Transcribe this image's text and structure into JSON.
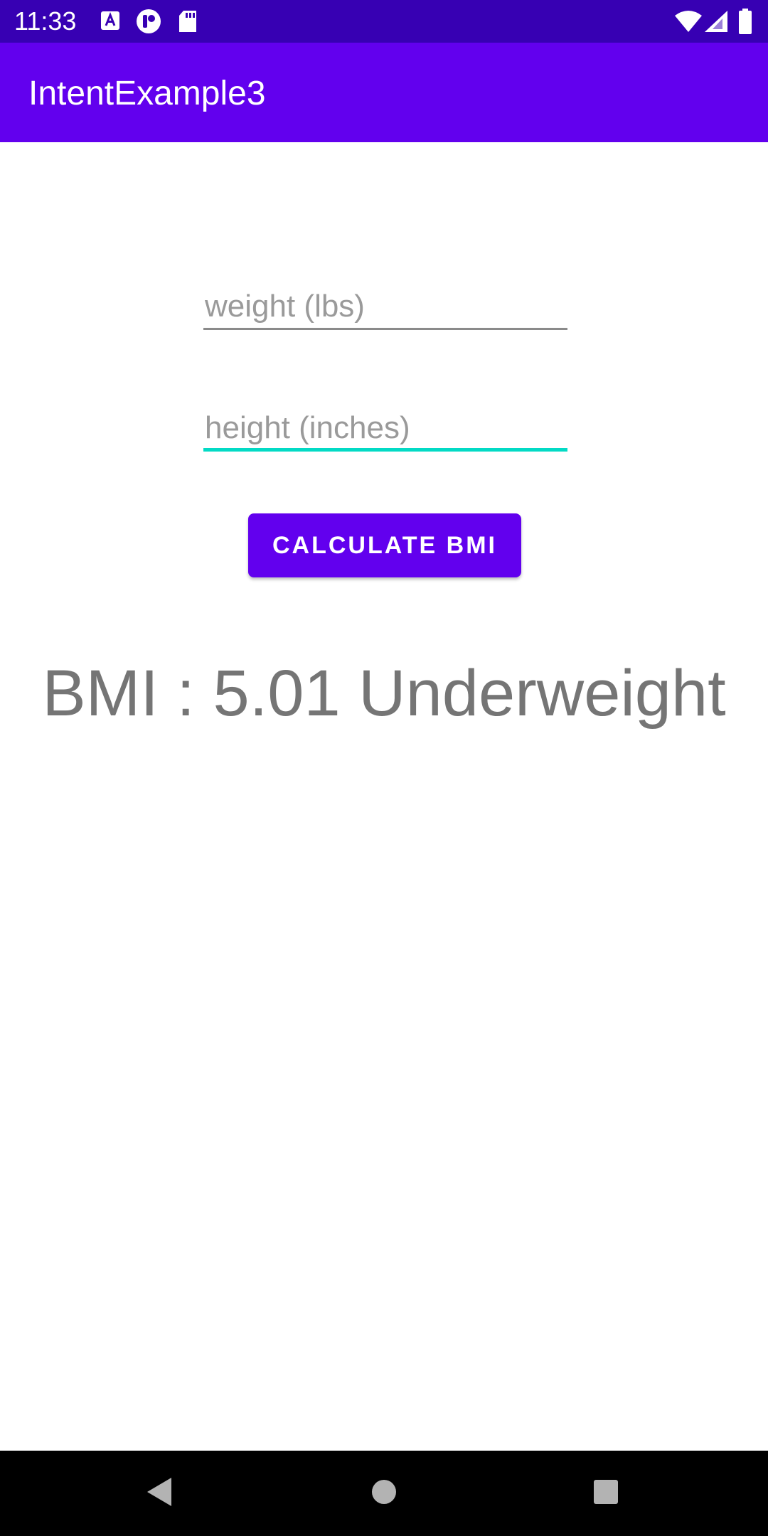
{
  "status_bar": {
    "time": "11:33",
    "left_icons": [
      "a-notification-icon",
      "app-notification-icon",
      "sd-card-icon"
    ],
    "right_icons": [
      "wifi-icon",
      "cell-signal-icon",
      "battery-icon"
    ]
  },
  "app_bar": {
    "title": "IntentExample3"
  },
  "form": {
    "weight": {
      "value": "",
      "placeholder": "weight (lbs)"
    },
    "height": {
      "value": "",
      "placeholder": "height (inches)",
      "focused": true
    },
    "calculate_label": "CALCULATE BMI"
  },
  "result": {
    "text": "BMI : 5.01 Underweight"
  },
  "nav_bar": {
    "buttons": [
      "back-icon",
      "home-icon",
      "recents-icon"
    ]
  },
  "colors": {
    "status_bar": "#3700b3",
    "primary": "#6200ee",
    "accent": "#03dac5",
    "result_text": "#757575"
  }
}
